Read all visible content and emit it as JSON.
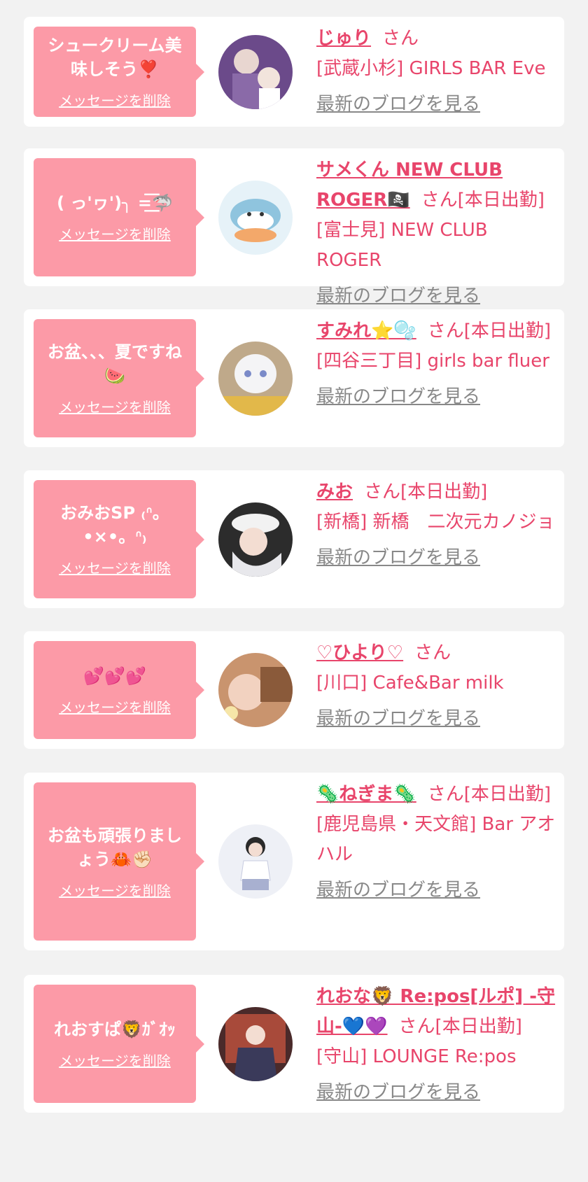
{
  "items": [
    {
      "message": "シュークリーム美味しそう❣️",
      "delete_label": "メッセージを削除",
      "name": "じゅり",
      "suffix": "さん",
      "shop": "[武蔵小杉] GIRLS BAR Eve",
      "blog_link": "最新のブログを見る",
      "avatar_color": "#6b4a8a"
    },
    {
      "message": "( っ'ヮ')╮ =͟͟͞͞🦈",
      "delete_label": "メッセージを削除",
      "name": "サメくん NEW CLUB ROGER🏴‍☠️",
      "suffix": "さん[本日出勤]",
      "shop": "[富士見] NEW CLUB ROGER",
      "blog_link": "最新のブログを見る",
      "avatar_color": "#cfe6f2"
    },
    {
      "message": "お盆、、、夏ですね🍉",
      "delete_label": "メッセージを削除",
      "name": "すみれ⭐️🫧",
      "suffix": "さん[本日出勤]",
      "shop": "[四谷三丁目] girls bar fluer",
      "blog_link": "最新のブログを見る",
      "avatar_color": "#bfa98a"
    },
    {
      "message": "おみおSP ₍ᐢ。•×•。ᐢ₎",
      "delete_label": "メッセージを削除",
      "name": "みお",
      "suffix": "さん[本日出勤]",
      "shop": "[新橋] 新橋　二次元カノジョ",
      "blog_link": "最新のブログを見る",
      "avatar_color": "#3a3a3a"
    },
    {
      "message": "💕💕💕",
      "delete_label": "メッセージを削除",
      "name": "♡ひより♡",
      "suffix": "さん",
      "shop": "[川口] Cafe&Bar milk",
      "blog_link": "最新のブログを見る",
      "avatar_color": "#c9946e"
    },
    {
      "message": "お盆も頑張りましょう🦀✊🏻",
      "delete_label": "メッセージを削除",
      "name": "🦠ねぎま🦠",
      "suffix": "さん[本日出勤]",
      "shop": "[鹿児島県・天文館] Bar アオハル",
      "blog_link": "最新のブログを見る",
      "avatar_color": "#e9edf5"
    },
    {
      "message": "れおすぱ🦁ｶﾞｵｯ",
      "delete_label": "メッセージを削除",
      "name": "れおな🦁 Re:pos[ルポ] -守山-💙💜",
      "suffix": "さん[本日出勤]",
      "shop": "[守山] LOUNGE Re:pos",
      "blog_link": "最新のブログを見る",
      "avatar_color": "#4a2a2a"
    }
  ]
}
